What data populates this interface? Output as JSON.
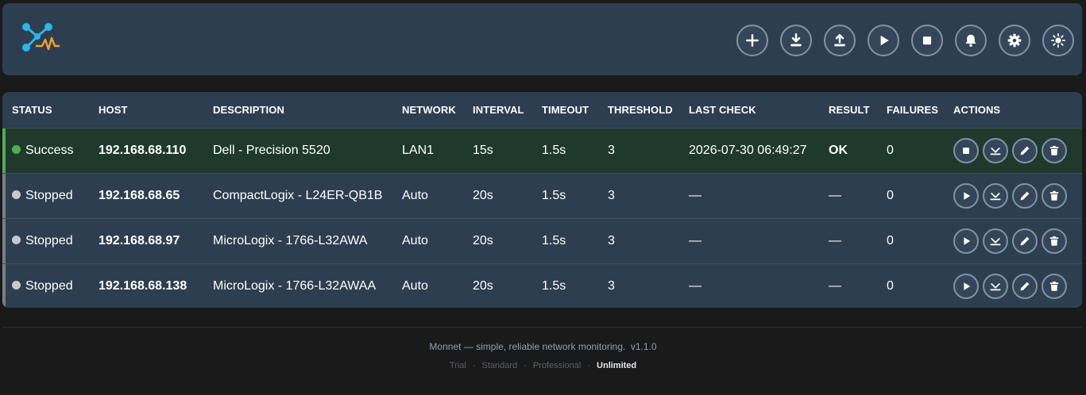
{
  "app": {
    "logo_icon": "network-pulse-logo",
    "toolbar": [
      {
        "name": "add-host-button",
        "icon": "plus-icon"
      },
      {
        "name": "import-button",
        "icon": "download-icon"
      },
      {
        "name": "export-button",
        "icon": "upload-icon"
      },
      {
        "name": "start-all-button",
        "icon": "play-icon"
      },
      {
        "name": "stop-all-button",
        "icon": "stop-icon"
      },
      {
        "name": "notifications-button",
        "icon": "bell-icon"
      },
      {
        "name": "settings-button",
        "icon": "gear-icon"
      },
      {
        "name": "theme-toggle-button",
        "icon": "sun-icon"
      }
    ]
  },
  "table": {
    "headers": [
      "STATUS",
      "HOST",
      "DESCRIPTION",
      "NETWORK",
      "INTERVAL",
      "TIMEOUT",
      "THRESHOLD",
      "LAST CHECK",
      "RESULT",
      "FAILURES",
      "ACTIONS"
    ],
    "rows": [
      {
        "status": "Success",
        "host": "192.168.68.110",
        "description": "Dell - Precision 5520",
        "network": "LAN1",
        "interval": "15s",
        "timeout": "1.5s",
        "threshold": "3",
        "last_check": "2026-07-30 06:49:27",
        "result": "OK",
        "failures": "0"
      },
      {
        "status": "Stopped",
        "host": "192.168.68.65",
        "description": "CompactLogix - L24ER-QB1B",
        "network": "Auto",
        "interval": "20s",
        "timeout": "1.5s",
        "threshold": "3",
        "last_check": "—",
        "result": "—",
        "failures": "0"
      },
      {
        "status": "Stopped",
        "host": "192.168.68.97",
        "description": "MicroLogix - 1766-L32AWA",
        "network": "Auto",
        "interval": "20s",
        "timeout": "1.5s",
        "threshold": "3",
        "last_check": "—",
        "result": "—",
        "failures": "0"
      },
      {
        "status": "Stopped",
        "host": "192.168.68.138",
        "description": "MicroLogix - 1766-L32AWAA",
        "network": "Auto",
        "interval": "20s",
        "timeout": "1.5s",
        "threshold": "3",
        "last_check": "—",
        "result": "—",
        "failures": "0"
      }
    ]
  },
  "footer": {
    "tagline": "Monnet — simple, reliable network monitoring.",
    "version": "v1.1.0",
    "plans": [
      "Trial",
      "Standard",
      "Professional",
      "Unlimited"
    ],
    "active_plan": "Unlimited"
  },
  "colors": {
    "header_bg": "#2d3e50",
    "success": "#4caf50",
    "stopped": "#c7c9cc",
    "success_row_bg": "#1f3a2d"
  }
}
